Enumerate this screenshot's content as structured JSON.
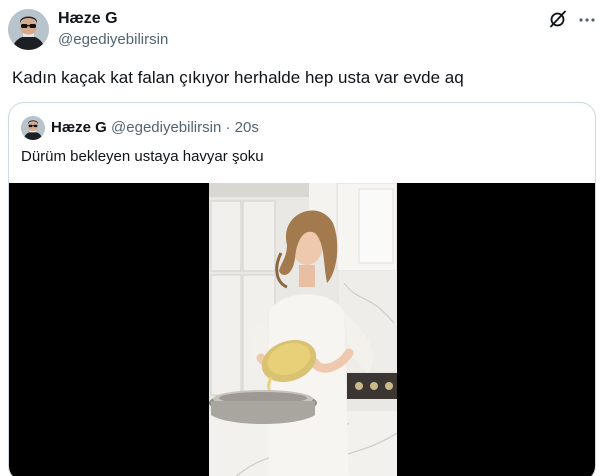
{
  "tweet": {
    "author_name": "Hæze G",
    "author_handle": "@egediyebilirsin",
    "text": "Kadın kaçak kat falan çıkıyor herhalde hep usta var evde aq",
    "avatar": "profile-avatar-sunglasses",
    "actions": {
      "grok_icon": "grok-icon",
      "more_icon": "more-icon"
    }
  },
  "quote": {
    "author_name": "Hæze G",
    "author_handle": "@egediyebilirsin",
    "separator": "·",
    "time": "20s",
    "text": "Dürüm bekleyen ustaya havyar şoku",
    "media": {
      "type": "video",
      "subject": "woman pouring batter into a pan in a white kitchen"
    }
  },
  "colors": {
    "text_primary": "#0f1419",
    "text_secondary": "#536471",
    "border": "#cfd9de",
    "media_bg": "#000000"
  }
}
